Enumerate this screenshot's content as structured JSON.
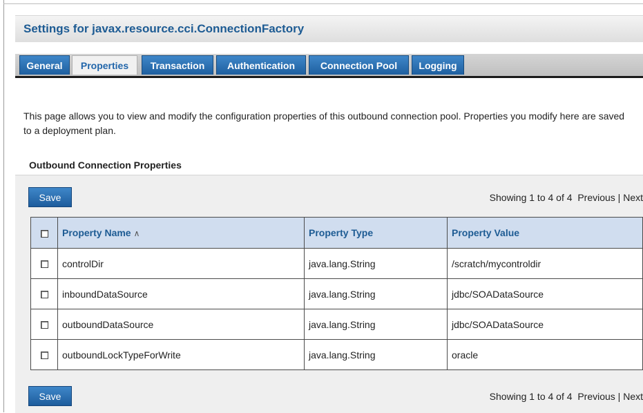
{
  "header": {
    "title": "Settings for javax.resource.cci.ConnectionFactory"
  },
  "tabs": [
    {
      "label": "General"
    },
    {
      "label": "Properties",
      "active": true
    },
    {
      "label": "Transaction"
    },
    {
      "label": "Authentication"
    },
    {
      "label": "Connection Pool"
    },
    {
      "label": "Logging"
    }
  ],
  "description": "This page allows you to view and modify the configuration properties of this outbound connection pool. Properties you modify here are saved to a deployment plan.",
  "section": {
    "title": "Outbound Connection Properties"
  },
  "toolbar": {
    "save_label": "Save",
    "showing": "Showing 1 to 4 of 4",
    "previous": "Previous",
    "separator": "|",
    "next": "Next"
  },
  "table": {
    "columns": [
      "Property Name",
      "Property Type",
      "Property Value"
    ],
    "sort_icon": "sort-ascending-icon",
    "rows": [
      {
        "name": "controlDir",
        "type": "java.lang.String",
        "value": "/scratch/mycontroldir"
      },
      {
        "name": "inboundDataSource",
        "type": "java.lang.String",
        "value": "jdbc/SOADataSource"
      },
      {
        "name": "outboundDataSource",
        "type": "java.lang.String",
        "value": "jdbc/SOADataSource"
      },
      {
        "name": "outboundLockTypeForWrite",
        "type": "java.lang.String",
        "value": "oracle"
      }
    ]
  },
  "colors": {
    "title": "#1d5b93",
    "tab_blue": "#2a72b6",
    "header_row": "#d0ddef",
    "button_blue": "#2c6fb0"
  }
}
